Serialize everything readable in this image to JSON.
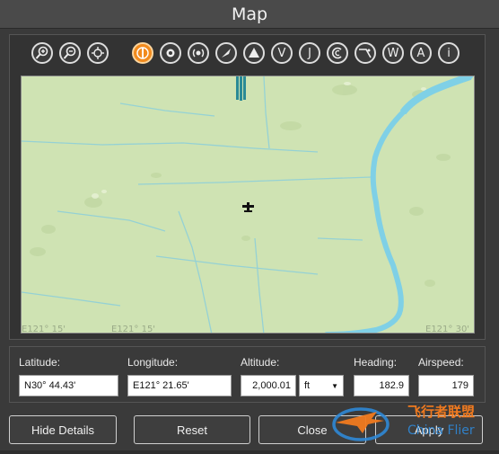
{
  "window": {
    "title": "Map"
  },
  "toolbar": {
    "buttons": [
      {
        "name": "zoom-in-icon",
        "glyph": ""
      },
      {
        "name": "zoom-out-icon",
        "glyph": ""
      },
      {
        "name": "center-icon",
        "glyph": ""
      },
      {
        "name": "airport-icon",
        "glyph": ""
      },
      {
        "name": "ndb-icon",
        "glyph": ""
      },
      {
        "name": "vor-icon",
        "glyph": ""
      },
      {
        "name": "ils-icon",
        "glyph": ""
      },
      {
        "name": "intersection-icon",
        "glyph": ""
      },
      {
        "name": "v-airway-icon",
        "glyph": "V"
      },
      {
        "name": "j-airway-icon",
        "glyph": "J"
      },
      {
        "name": "terrain-icon",
        "glyph": ""
      },
      {
        "name": "flight-path-icon",
        "glyph": ""
      },
      {
        "name": "w-icon",
        "glyph": "W"
      },
      {
        "name": "a-icon",
        "glyph": "A"
      },
      {
        "name": "info-icon",
        "glyph": "i"
      }
    ]
  },
  "map": {
    "labels": {
      "bottom_left": "E121° 15'",
      "bottom_center": "E121° 15'",
      "bottom_right": "E121° 30'"
    }
  },
  "details": {
    "latitude": {
      "label": "Latitude:",
      "value": "N30° 44.43'"
    },
    "longitude": {
      "label": "Longitude:",
      "value": "E121° 21.65'"
    },
    "altitude": {
      "label": "Altitude:",
      "value": "2,000.01",
      "unit": "ft"
    },
    "heading": {
      "label": "Heading:",
      "value": "182.9"
    },
    "airspeed": {
      "label": "Airspeed:",
      "value": "179"
    }
  },
  "buttons": {
    "hide_details": "Hide Details",
    "reset": "Reset",
    "close": "Close",
    "apply": "Apply"
  },
  "watermark": {
    "text": "飞行者联盟",
    "subtext": "China Flier"
  }
}
